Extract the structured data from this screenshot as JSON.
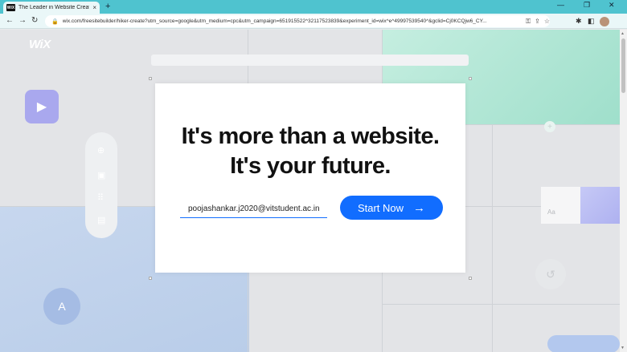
{
  "browser": {
    "tab": {
      "favicon_text": "WiX",
      "title": "The Leader in Website Creation |",
      "close": "×"
    },
    "new_tab": "+",
    "window_controls": {
      "minimize": "—",
      "maximize": "❐",
      "close": "✕"
    },
    "nav": {
      "back": "←",
      "forward": "→",
      "reload": "↻"
    },
    "url": "wix.com/freesitebuilder/hiker-create?utm_source=google&utm_medium=cpc&utm_campaign=651915522^32117523839&experiment_id=wix^e^49997539540^&gclid=Cj0KCQjw6_CY...",
    "omnibox_icons": {
      "lock": "🔒",
      "key": "⚿",
      "share": "⇪",
      "star": "☆"
    },
    "extensions": {
      "puzzle": "✱",
      "sidebar": "◧"
    }
  },
  "page": {
    "logo": "WiX",
    "aa_label": "Aa",
    "tool_icons": [
      "⊕",
      "▣",
      "⠿",
      "▤"
    ],
    "play_glyph": "▶",
    "side_glyph": "A",
    "plus_glyph": "+",
    "undo_glyph": "↺"
  },
  "modal": {
    "headline_line1": "It's more than a website.",
    "headline_line2": "It's your future.",
    "email_value": "poojashankar.j2020@vitstudent.ac.in",
    "start_label": "Start Now",
    "start_arrow": "→"
  },
  "colors": {
    "accent": "#116dff",
    "browser_frame": "#4fc3cf"
  }
}
